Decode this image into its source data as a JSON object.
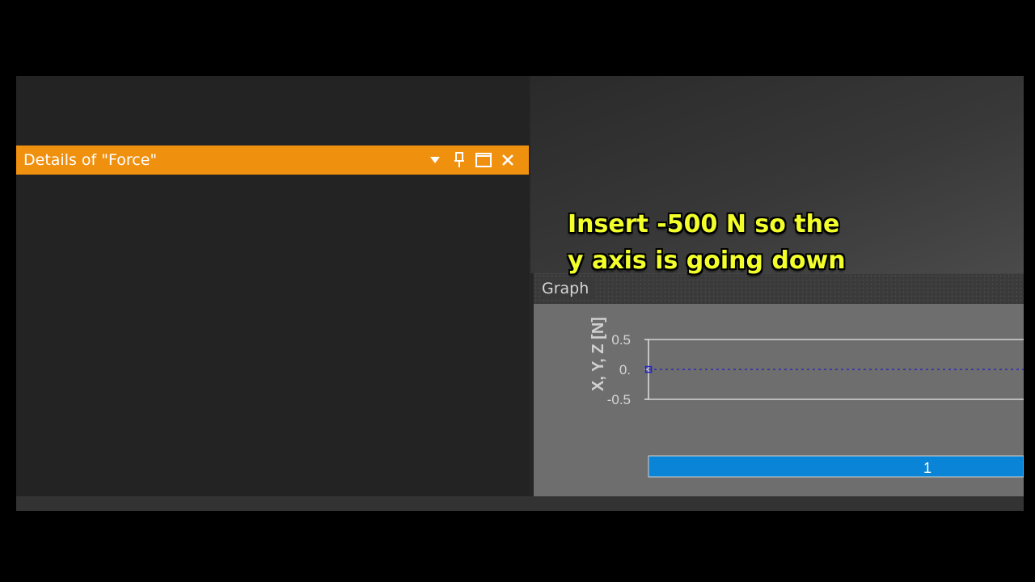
{
  "details": {
    "title": "Details of \"Force\"",
    "icons": [
      "dropdown-arrow-icon",
      "pin-icon",
      "maximize-icon",
      "close-icon"
    ],
    "accent_color": "#f0900f"
  },
  "graph": {
    "title": "Graph",
    "bar_label": "1",
    "bar_color": "#0a84d6"
  },
  "caption": {
    "line1": "Insert -500 N so the",
    "line2": "y axis is going down",
    "color": "#f3ff2a"
  },
  "chart_data": {
    "type": "line",
    "ylabel": "X, Y, Z [N]",
    "ylim": [
      -0.5,
      0.5
    ],
    "yticks": [
      "0.5",
      "0.",
      "-0.5"
    ],
    "series": [
      {
        "x": [
          0
        ],
        "values": [
          0
        ]
      }
    ]
  }
}
